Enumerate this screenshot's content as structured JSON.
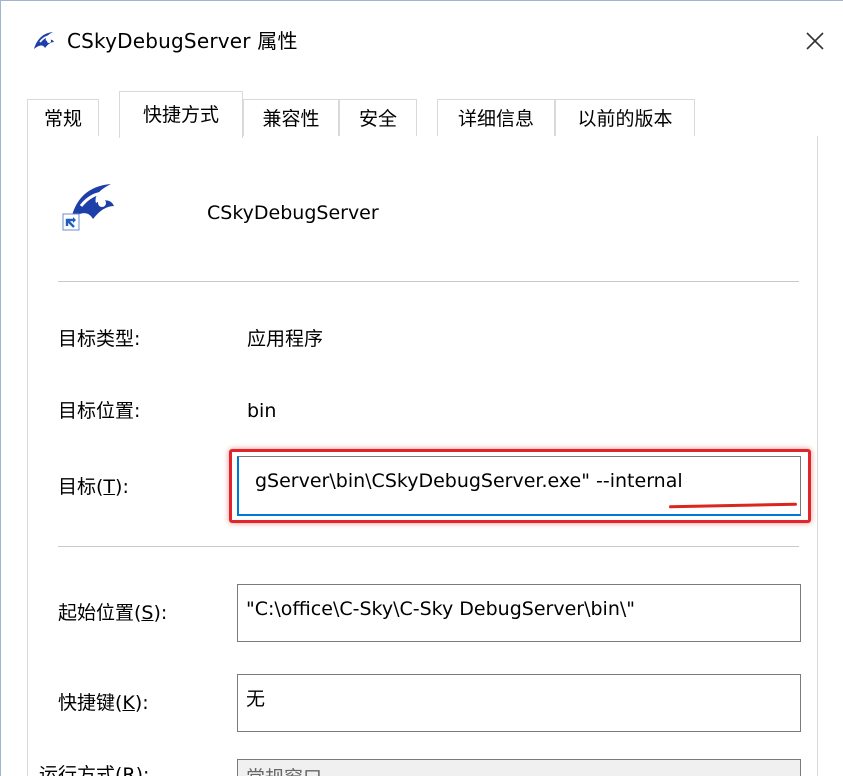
{
  "window": {
    "title": "CSkyDebugServer 属性",
    "icon": "csky-app-icon"
  },
  "tabs": [
    {
      "label": "常规",
      "active": false
    },
    {
      "label": "快捷方式",
      "active": true
    },
    {
      "label": "兼容性",
      "active": false
    },
    {
      "label": "安全",
      "active": false
    },
    {
      "label": "详细信息",
      "active": false
    },
    {
      "label": "以前的版本",
      "active": false
    }
  ],
  "shortcut": {
    "app_name": "CSkyDebugServer",
    "target_type_label": "目标类型:",
    "target_type_value": "应用程序",
    "target_location_label": "目标位置:",
    "target_location_value": "bin",
    "target_label_prefix": "目标(",
    "target_label_key": "T",
    "target_label_suffix": "):",
    "target_value": "gServer\\bin\\CSkyDebugServer.exe\"  --internal",
    "start_in_label_prefix": "起始位置(",
    "start_in_label_key": "S",
    "start_in_label_suffix": "):",
    "start_in_value": "\"C:\\office\\C-Sky\\C-Sky DebugServer\\bin\\\"",
    "hotkey_label_prefix": "快捷键(",
    "hotkey_label_key": "K",
    "hotkey_label_suffix": "):",
    "hotkey_value": "无",
    "run_label": "运行方式(R):",
    "run_value": "常规窗口"
  },
  "colors": {
    "highlight": "#e0262a",
    "focus_border": "#0078d7"
  }
}
